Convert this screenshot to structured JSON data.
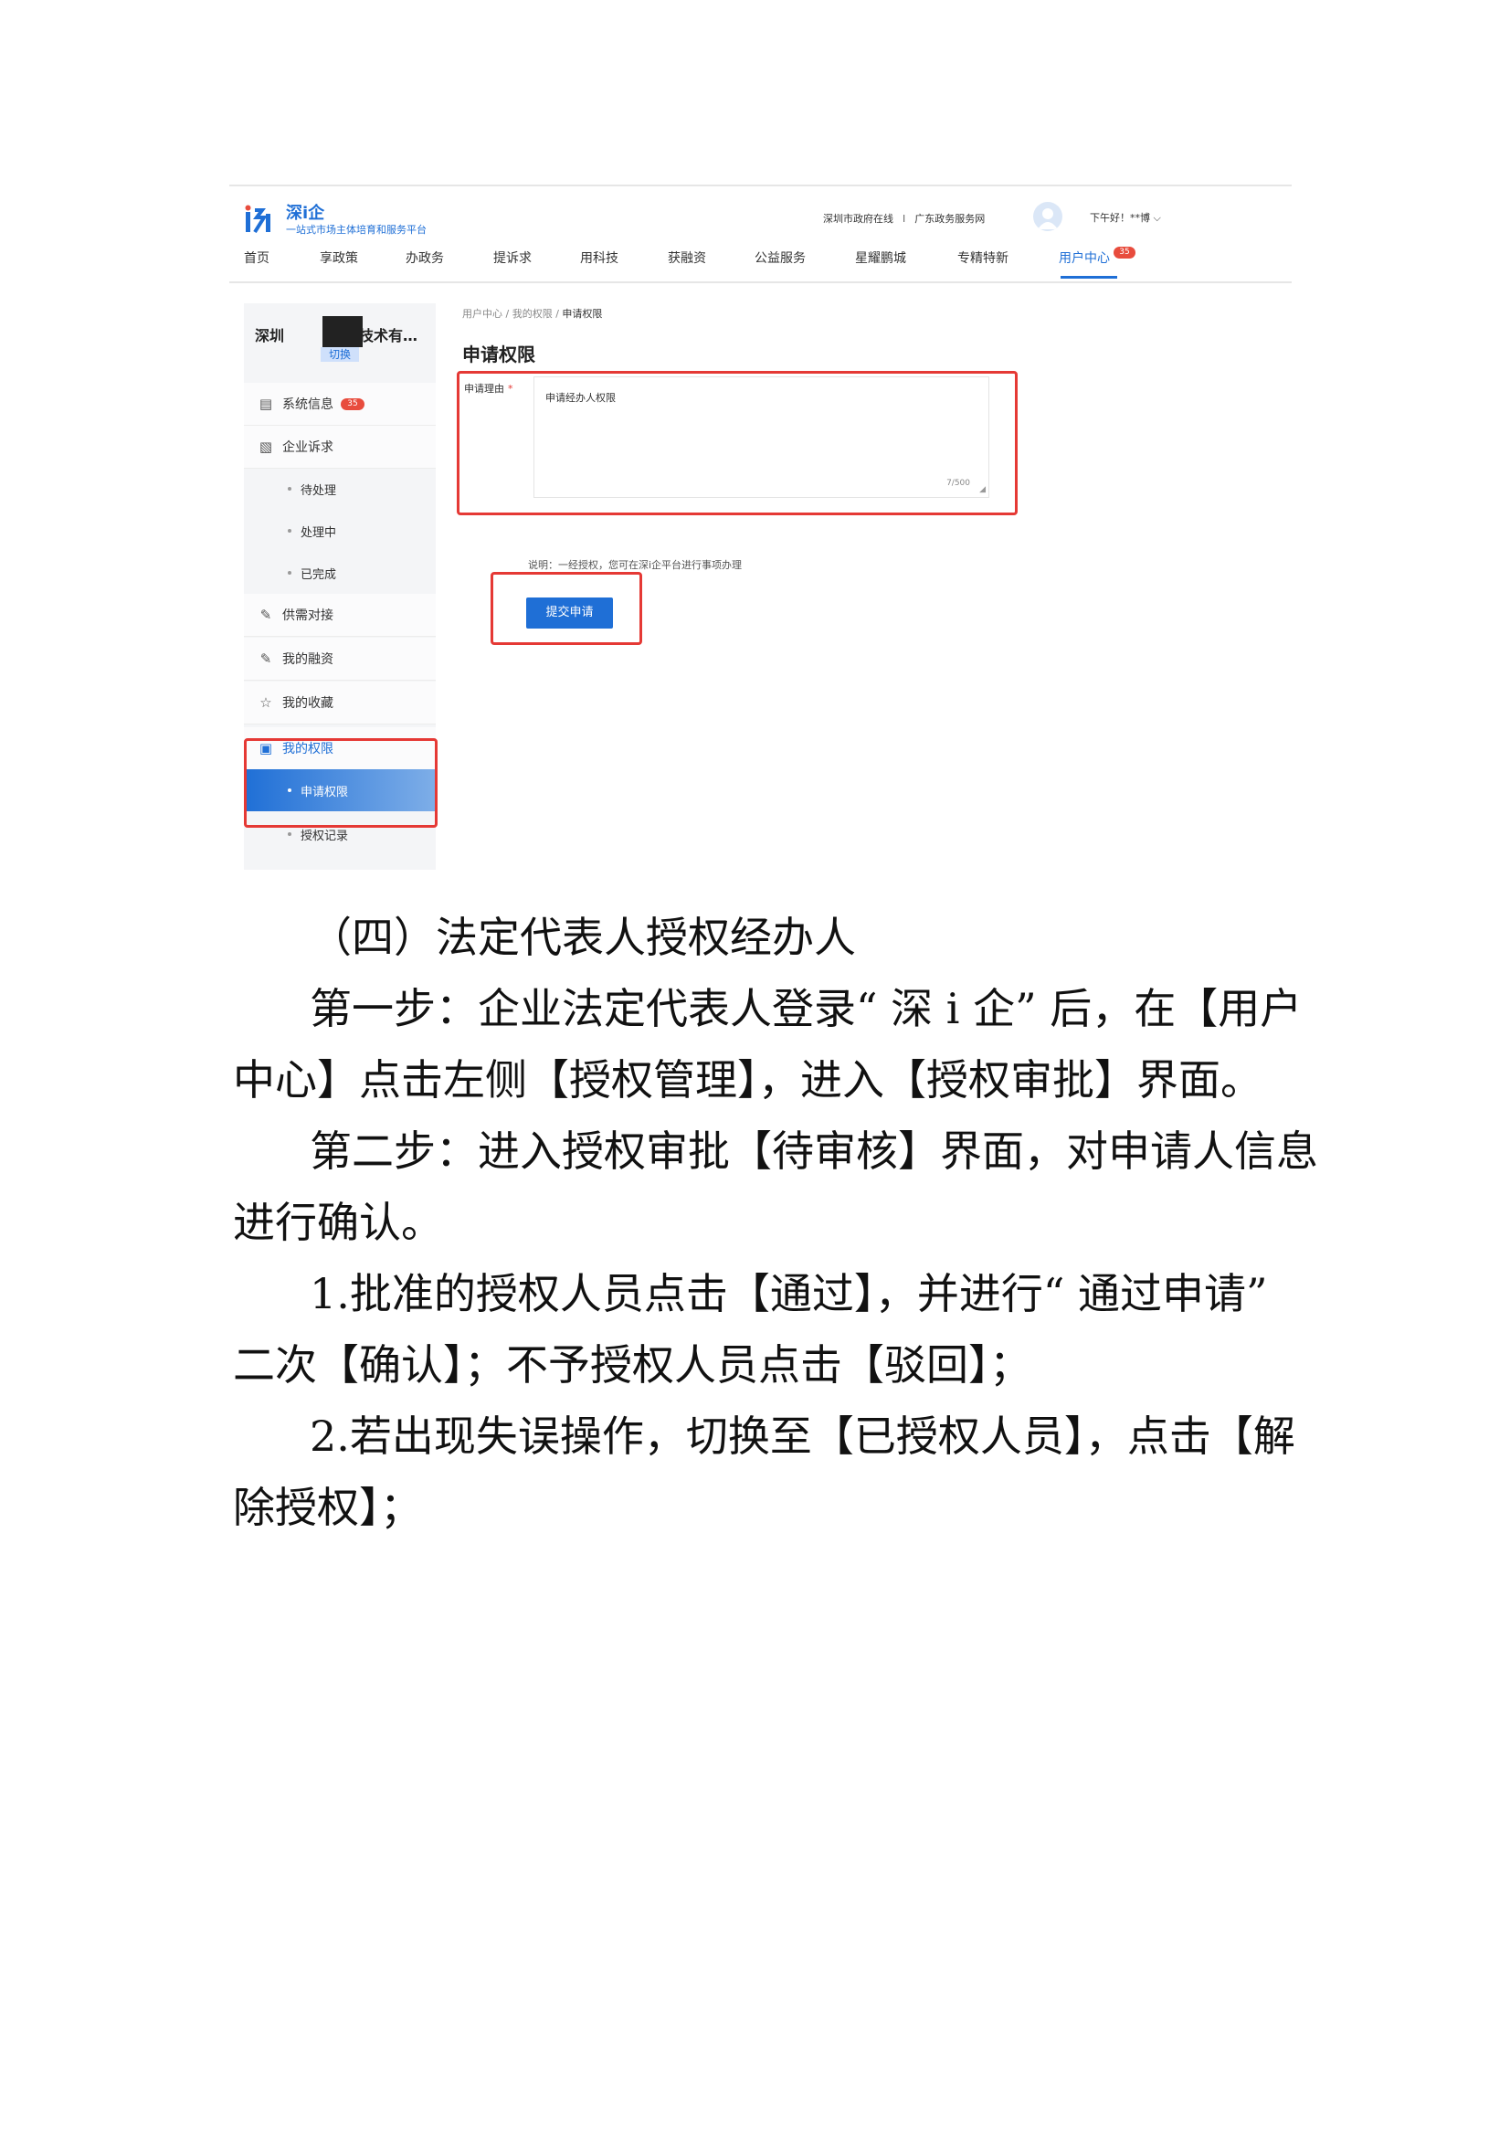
{
  "screenshot": {
    "brand": "深i企",
    "brand_subtitle": "一站式市场主体培育和服务平台",
    "top_links": [
      "深圳市政府在线",
      "广东政务服务网"
    ],
    "top_link_separator": "I",
    "greeting": "下午好！**博 ⌵",
    "nav": [
      {
        "label": "首页"
      },
      {
        "label": "享政策"
      },
      {
        "label": "办政务"
      },
      {
        "label": "提诉求"
      },
      {
        "label": "用科技"
      },
      {
        "label": "获融资"
      },
      {
        "label": "公益服务"
      },
      {
        "label": "星耀鹏城"
      },
      {
        "label": "专精特新"
      },
      {
        "label": "用户中心",
        "active": true,
        "badge": "35"
      }
    ],
    "sidebar": {
      "company_prefix": "深圳",
      "company_suffix": "技术有…",
      "switch_label": "切换",
      "items": [
        {
          "label": "系统信息",
          "icon": "message-icon",
          "badge": "35"
        },
        {
          "label": "企业诉求",
          "icon": "document-icon"
        },
        {
          "label": "待处理",
          "sub": true
        },
        {
          "label": "处理中",
          "sub": true
        },
        {
          "label": "已完成",
          "sub": true
        },
        {
          "label": "供需对接",
          "icon": "edit-doc-icon"
        },
        {
          "label": "我的融资",
          "icon": "edit-doc-icon"
        },
        {
          "label": "我的收藏",
          "icon": "star-icon"
        },
        {
          "label": "我的权限",
          "icon": "permission-icon",
          "active": true
        },
        {
          "label": "申请权限",
          "sub": true,
          "selected": true
        },
        {
          "label": "授权记录",
          "sub": true
        }
      ]
    },
    "breadcrumb": [
      "用户中心",
      "我的权限",
      "申请权限"
    ],
    "panel_title": "申请权限",
    "field_label": "申请理由",
    "field_required_mark": "*",
    "field_value": "申请经办人权限",
    "char_count": "7/500",
    "note": "说明：一经授权，您可在深i企平台进行事项办理",
    "submit_label": "提交申请"
  },
  "document": {
    "heading": "（四）法定代表人授权经办人",
    "lines": [
      "第一步：企业法定代表人登录“ 深 i 企” 后，在【用户",
      "中心】点击左侧【授权管理】，进入【授权审批】界面。",
      "第二步：进入授权审批【待审核】界面，对申请人信息",
      "进行确认。",
      "1.批准的授权人员点击【通过】，并进行“ 通过申请”",
      "二次【确认】；不予授权人员点击【驳回】；",
      "2.若出现失误操作，切换至【已授权人员】，点击【解",
      "除授权】；"
    ]
  }
}
